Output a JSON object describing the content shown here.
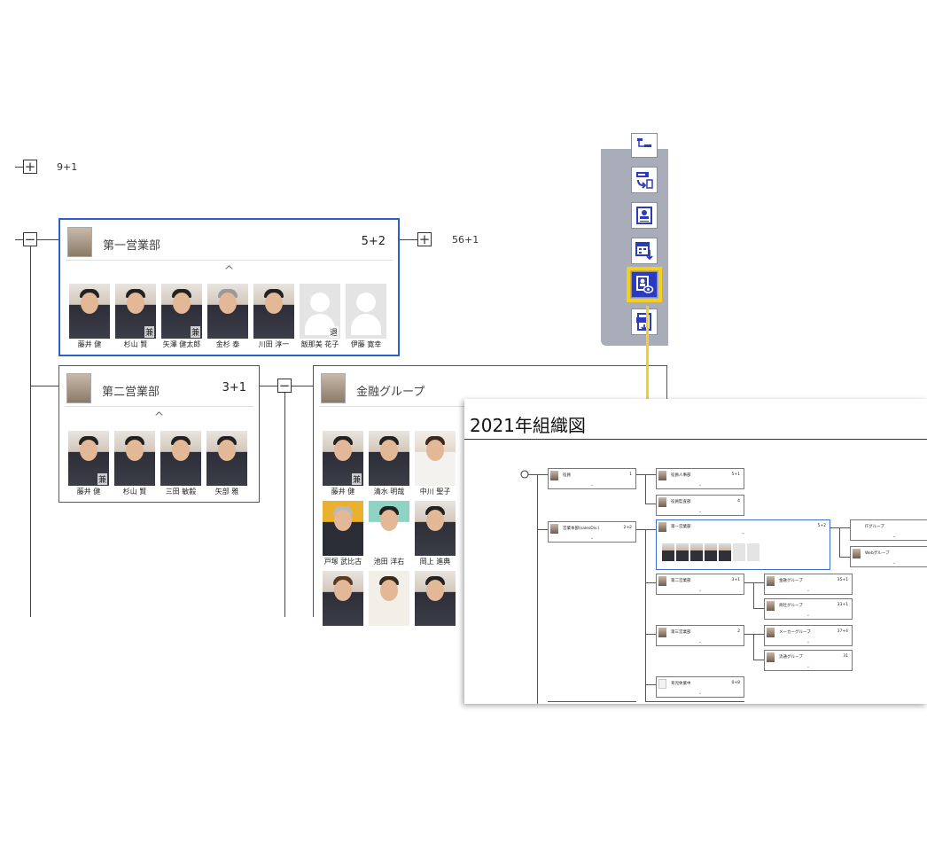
{
  "tree": {
    "top_node": {
      "toggle": "+",
      "count": "9+1"
    },
    "right_node": {
      "toggle": "+",
      "count": "56+1"
    },
    "left_toggle": "−",
    "mid_toggle": "−"
  },
  "cards": {
    "dept1": {
      "title": "第一営業部",
      "count": "5+2",
      "caret": "^",
      "members": [
        {
          "name": "藤井 健",
          "tag": ""
        },
        {
          "name": "杉山 賢",
          "tag": "兼"
        },
        {
          "name": "矢澤 健太郎",
          "tag": "兼"
        },
        {
          "name": "金杉 泰",
          "tag": ""
        },
        {
          "name": "川田 淳一",
          "tag": ""
        },
        {
          "name": "飯那美 花子",
          "tag": "退"
        },
        {
          "name": "伊藤 寛幸",
          "tag": ""
        }
      ]
    },
    "dept2": {
      "title": "第二営業部",
      "count": "3+1",
      "caret": "^",
      "members": [
        {
          "name": "藤井 健",
          "tag": "兼"
        },
        {
          "name": "杉山 賢",
          "tag": ""
        },
        {
          "name": "三田 敏毅",
          "tag": ""
        },
        {
          "name": "矢部 雅",
          "tag": ""
        }
      ]
    },
    "finance": {
      "title": "金融グループ",
      "members": [
        {
          "name": "藤井 健",
          "tag": "兼"
        },
        {
          "name": "清水 明哉",
          "tag": ""
        },
        {
          "name": "中川 聖子",
          "tag": ""
        },
        {
          "name": "戸塚 武比古",
          "tag": ""
        },
        {
          "name": "池田 洋右",
          "tag": ""
        },
        {
          "name": "岡上 進典",
          "tag": ""
        },
        {
          "name": "",
          "tag": ""
        },
        {
          "name": "",
          "tag": ""
        },
        {
          "name": "",
          "tag": ""
        }
      ]
    }
  },
  "toolbar": {
    "icons": [
      "org-layout-icon",
      "swap-export-icon",
      "profile-card-icon",
      "calendar-sync-icon",
      "preview-eye-icon",
      "image-export-icon"
    ],
    "highlight_color": "#f5cf19",
    "active_color": "#2b3bbd"
  },
  "preview": {
    "title": "2021年組織図",
    "nodes": {
      "yakuin": {
        "title": "役員",
        "count": "1"
      },
      "yakuin_jimu": {
        "title": "役員人事部",
        "count": "5+1"
      },
      "yakuin_kansa": {
        "title": "役員監査部",
        "count": "4"
      },
      "eigyo_honbu": {
        "title": "営業本部(salesDiv.)",
        "count": "2+2"
      },
      "dai1": {
        "title": "第一営業部",
        "count": "5+2"
      },
      "dai2": {
        "title": "第二営業部",
        "count": "3+1"
      },
      "dai3": {
        "title": "第三営業部",
        "count": "2"
      },
      "ikuji": {
        "title": "育児休業中",
        "count": "0+8"
      },
      "it": {
        "title": "ITグループ",
        "count": ""
      },
      "web": {
        "title": "Webグループ",
        "count": ""
      },
      "kinyu": {
        "title": "金融グループ",
        "count": "35+1"
      },
      "shosha": {
        "title": "商社グループ",
        "count": "33+1"
      },
      "maker": {
        "title": "メーカーグループ",
        "count": "37+4"
      },
      "ryutsu": {
        "title": "流通グループ",
        "count": "31"
      }
    }
  }
}
